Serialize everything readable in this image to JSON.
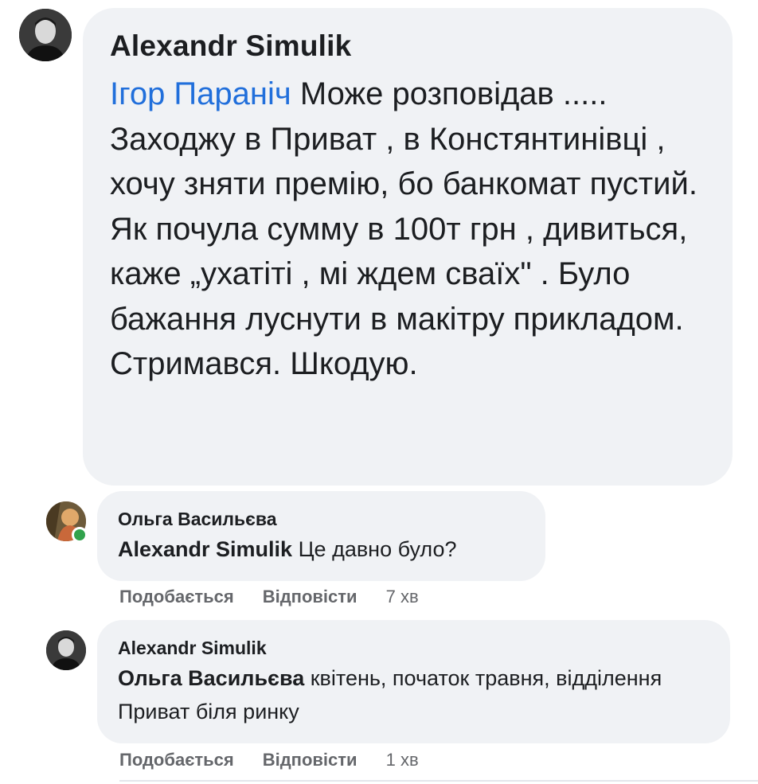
{
  "comments": [
    {
      "author": "Alexandr  Simulik",
      "mention": "Ігор Параніч",
      "text": " Може розповідав ..... Заходжу в Приват , в Констянтинівці , хочу зняти премію, бо банкомат пустий. Як почула сумму в 100т грн , дивиться, каже „ухатіті , мі ждем сваїх\" . Було бажання луснути в макітру прикладом. Стримався. Шкодую."
    },
    {
      "author": "Ольга Васильєва",
      "mention": "Alexandr Simulik",
      "text": " Це давно було?",
      "like_label": "Подобається",
      "reply_label": "Відповісти",
      "time": "7 хв",
      "online": true
    },
    {
      "author": "Alexandr Simulik",
      "mention": "Ольга Васильєва",
      "text": " квітень, початок травня, відділення Приват біля ринку",
      "like_label": "Подобається",
      "reply_label": "Відповісти",
      "time": "1 хв"
    }
  ],
  "colors": {
    "bubble": "#f0f2f5",
    "mention_link": "#216fdb",
    "secondary_text": "#65676b",
    "online": "#31a24c"
  }
}
